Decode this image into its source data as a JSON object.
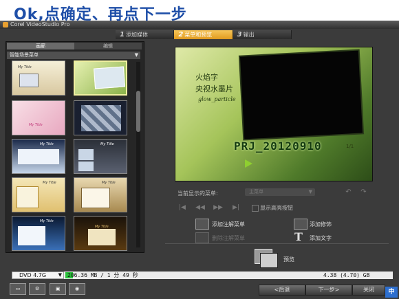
{
  "caption": "Ok,点确定、再点下一步",
  "window": {
    "title": "Corel VideoStudio Pro"
  },
  "steps": [
    {
      "num": "1",
      "label": "添加媒体"
    },
    {
      "num": "2",
      "label": "菜单和预览"
    },
    {
      "num": "3",
      "label": "输出"
    }
  ],
  "left_panel": {
    "tabs": [
      "画廊",
      "编辑"
    ],
    "dropdown": "智能场景菜单",
    "thumbs": [
      {
        "title": "My Title"
      },
      {
        "title": ""
      },
      {
        "title": "My Title"
      },
      {
        "title": ""
      },
      {
        "title": "My Title"
      },
      {
        "title": "My Title"
      },
      {
        "title": "My Title"
      },
      {
        "title": "My Title"
      },
      {
        "title": "My Title"
      },
      {
        "title": "My Title"
      }
    ]
  },
  "preview": {
    "line1": "火焰字",
    "line2": "央视水墨片",
    "line3": "glow_particle",
    "project_title": "PRJ_20120910",
    "page": "1/1"
  },
  "menu": {
    "current_label": "当前显示的菜单:",
    "current_value": "主菜单",
    "show_highlight": "显示高亮按钮"
  },
  "actions": {
    "add_note_menu": "添加注解菜单",
    "delete_note_menu": "删除注解菜单",
    "add_decoration": "添加修饰",
    "add_text": "添加文字",
    "preview": "预览"
  },
  "status": {
    "disc": "DVD 4.7G",
    "size_info": "206.36 MB / 1 分 49 秒",
    "capacity": "4.38 (4.70) GB"
  },
  "buttons": {
    "back": "<后退",
    "next": "下一步>",
    "close": "关闭"
  },
  "ime": "中"
}
